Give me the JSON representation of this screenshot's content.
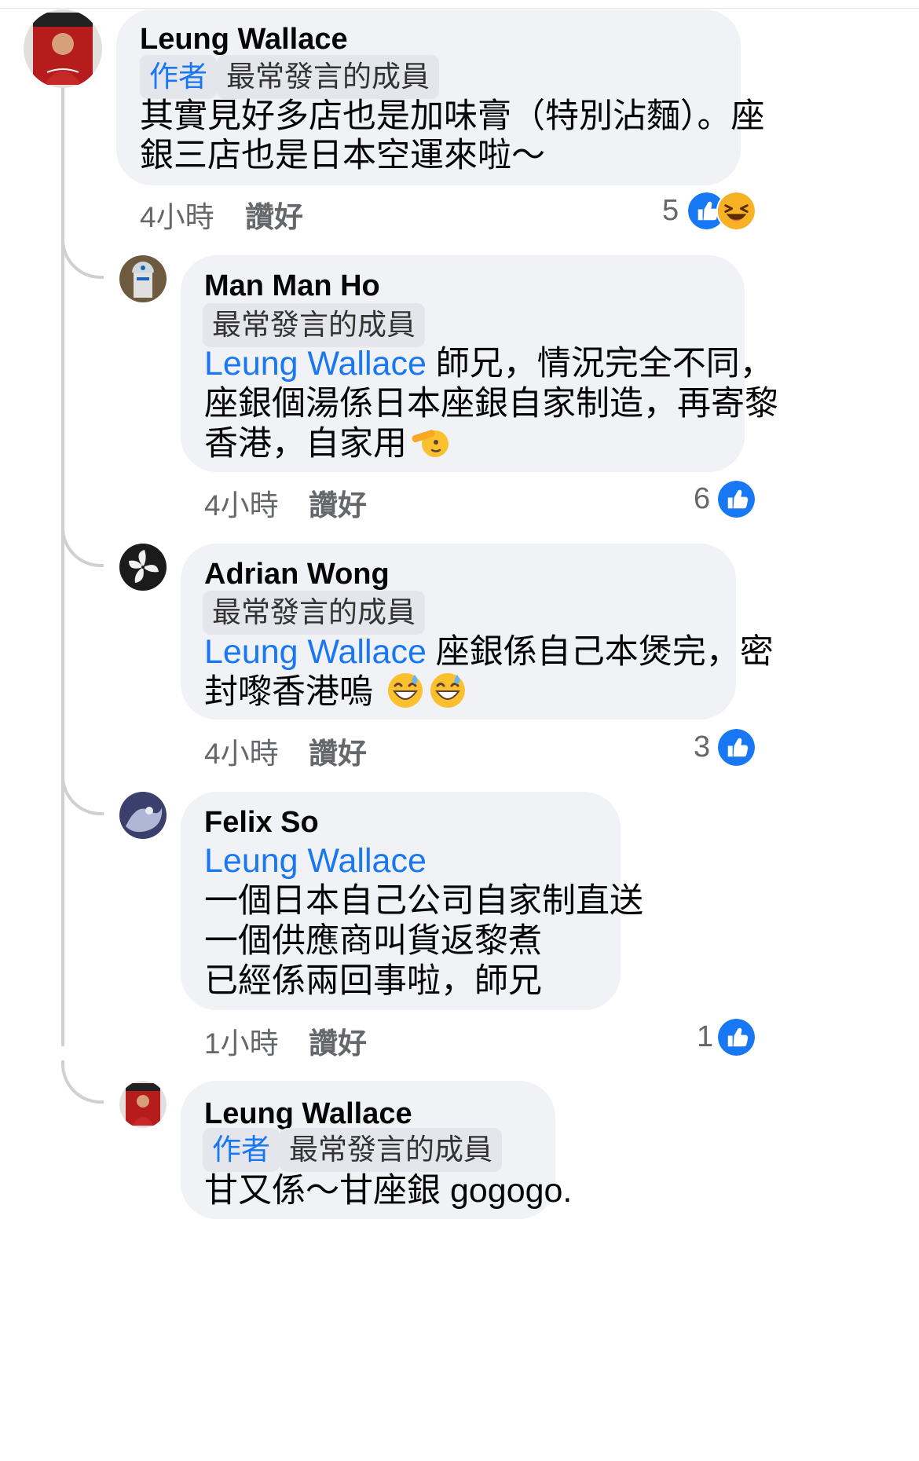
{
  "comments": [
    {
      "author": "Leung Wallace",
      "badges": [
        "作者",
        "最常發言的成員"
      ],
      "lines": [
        "其實見好多店也是加味膏（特別沾麵）。座",
        "銀三店也是日本空運來啦～"
      ],
      "time": "4小時",
      "like_label": "讚好",
      "reaction_count": "5"
    },
    {
      "author": "Man Man Ho",
      "badges": [
        "最常發言的成員"
      ],
      "mention": "Leung Wallace",
      "lines": [
        " 師兄，情況完全不同，",
        "座銀個湯係日本座銀自家制造，再寄黎",
        "香港，自家用"
      ],
      "time": "4小時",
      "like_label": "讚好",
      "reaction_count": "6"
    },
    {
      "author": "Adrian Wong",
      "badges": [
        "最常發言的成員"
      ],
      "mention": "Leung Wallace",
      "lines": [
        " 座銀係自己本煲完，密",
        "封嚟香港嗚"
      ],
      "time": "4小時",
      "like_label": "讚好",
      "reaction_count": "3"
    },
    {
      "author": "Felix So",
      "mention": "Leung Wallace",
      "lines": [
        "一個日本自己公司自家制直送",
        "一個供應商叫貨返黎煮",
        "已經係兩回事啦，師兄"
      ],
      "time": "1小時",
      "like_label": "讚好",
      "reaction_count": "1"
    },
    {
      "author": "Leung Wallace",
      "badges": [
        "作者",
        "最常發言的成員"
      ],
      "lines": [
        "甘又係～甘座銀 gogogo."
      ]
    }
  ],
  "colors": {
    "accent": "#1877f2",
    "bubble": "#f0f2f5",
    "secondary_text": "#65676b",
    "haha": "#f7b125"
  },
  "icons": [
    "like-reaction-icon",
    "haha-reaction-icon",
    "saluting-face-emoji-icon",
    "grinning-sweat-emoji-icon"
  ]
}
